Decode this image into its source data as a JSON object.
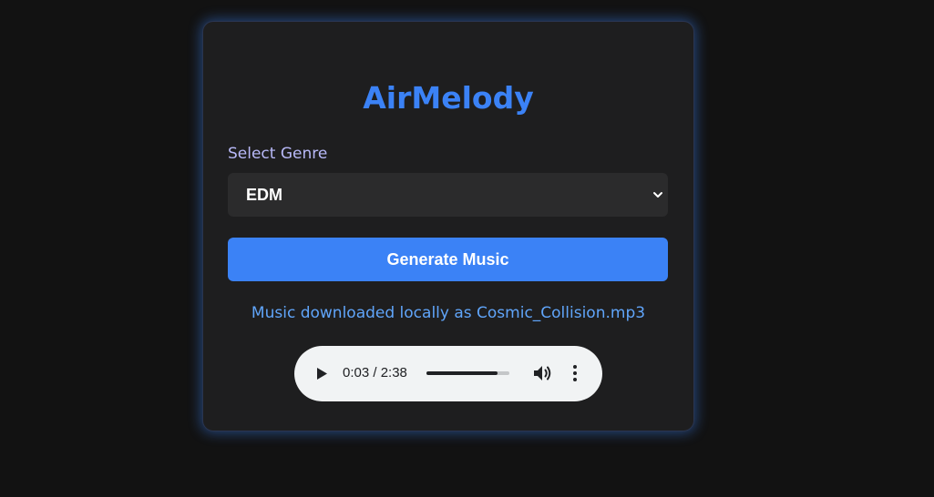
{
  "app": {
    "title": "AirMelody",
    "accent_color": "#3b82f6"
  },
  "genre": {
    "label": "Select Genre",
    "selected": "EDM",
    "chevron_icon": "chevron-down-icon"
  },
  "actions": {
    "generate_label": "Generate Music"
  },
  "status": {
    "message": "Music downloaded locally as Cosmic_Collision.mp3"
  },
  "player": {
    "time_display": "0:03 / 2:38",
    "progress_fraction": 0.86,
    "play_icon": "play-icon",
    "volume_icon": "volume-icon",
    "more_icon": "more-options-icon"
  }
}
